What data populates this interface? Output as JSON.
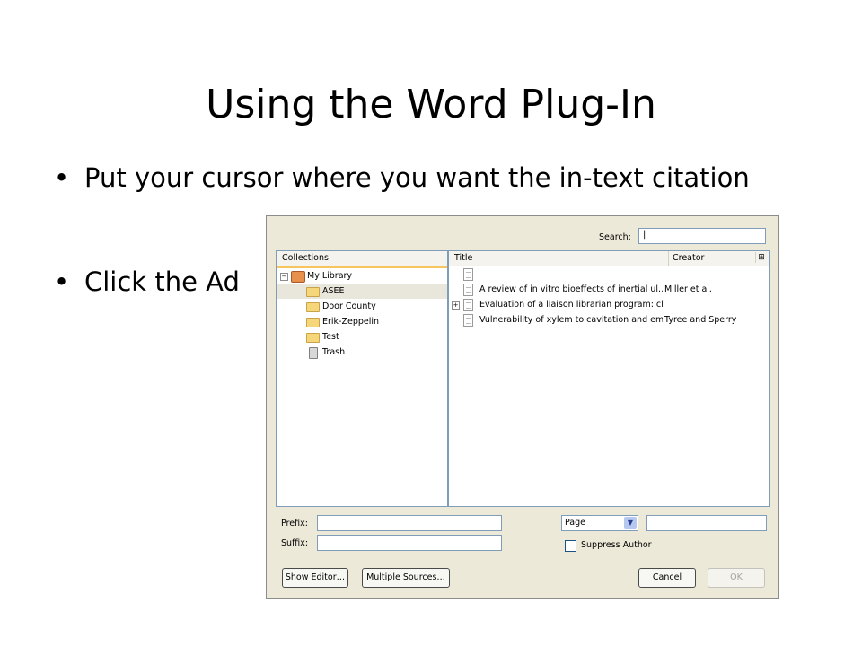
{
  "slide": {
    "title": "Using the Word Plug-In",
    "bullets": [
      "Put your cursor where you want the in-text citation",
      "Click the Ad"
    ]
  },
  "dialog": {
    "search_label": "Search:",
    "search_value": "",
    "collections_header": "Collections",
    "collections": [
      {
        "label": "My Library",
        "icon": "library-icon"
      },
      {
        "label": "ASEE",
        "icon": "folder-icon"
      },
      {
        "label": "Door County",
        "icon": "folder-icon"
      },
      {
        "label": "Erik-Zeppelin",
        "icon": "folder-icon"
      },
      {
        "label": "Test",
        "icon": "folder-icon"
      },
      {
        "label": "Trash",
        "icon": "trash-icon"
      }
    ],
    "items_header": {
      "title": "Title",
      "creator": "Creator"
    },
    "items": [
      {
        "title": "",
        "creator": ""
      },
      {
        "title": "A review of in vitro bioeffects of inertial ul…",
        "creator": "Miller et al."
      },
      {
        "title": "Evaluation of a liaison librarian program: cli…",
        "creator": ""
      },
      {
        "title": "Vulnerability of xylem to cavitation and em…",
        "creator": "Tyree and Sperry"
      }
    ],
    "prefix_label": "Prefix:",
    "suffix_label": "Suffix:",
    "locator_selected": "Page",
    "suppress_author_label": "Suppress Author",
    "buttons": {
      "show_editor": "Show Editor…",
      "multiple_sources": "Multiple Sources…",
      "cancel": "Cancel",
      "ok": "OK"
    }
  }
}
